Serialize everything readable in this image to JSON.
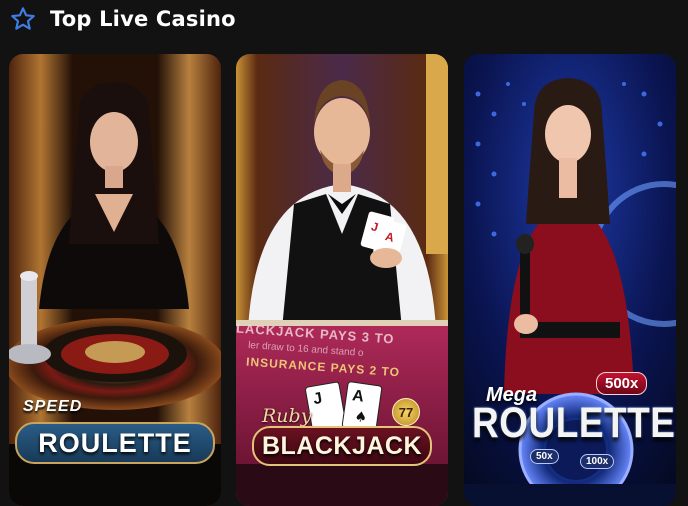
{
  "section": {
    "title": "Top Live Casino",
    "icon": "star-icon"
  },
  "colors": {
    "background": "#121212",
    "star": "#3f7de3",
    "title": "#ffffff"
  },
  "games": [
    {
      "name_sub": "SPEED",
      "name_main": "ROULETTE",
      "theme": "#c98a3a"
    },
    {
      "name_sub": "Ruby",
      "name_main": "BLACKJACK",
      "badge": "77",
      "table_text_1": "LACKJACK PAYS 3 TO",
      "table_text_2": "INSURANCE PAYS 2 TO",
      "table_text_3": "ler draw to 16 and stand o",
      "theme": "#7a1a3a"
    },
    {
      "name_sub": "Mega",
      "name_main": "ROULETTE",
      "multiplier_top": "500x",
      "multiplier_left": "50x",
      "multiplier_right": "100x",
      "theme": "#1a3a9a"
    }
  ]
}
